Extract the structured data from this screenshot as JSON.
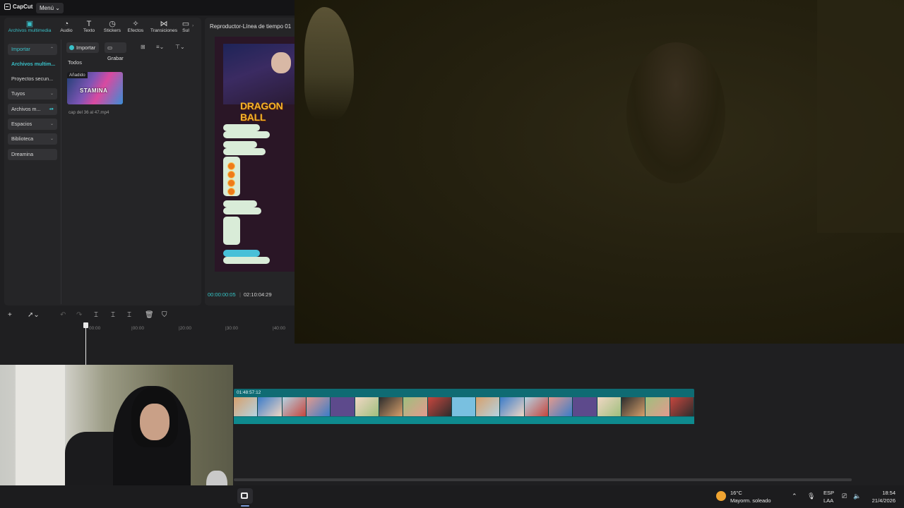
{
  "app": {
    "logo": "CapCut",
    "menu_label": "Menú"
  },
  "toolbar": {
    "tabs": [
      {
        "label": "Archivos multimedia",
        "icon": "media-icon"
      },
      {
        "label": "Audio",
        "icon": "audio-icon"
      },
      {
        "label": "Texto",
        "icon": "text-icon"
      },
      {
        "label": "Stickers",
        "icon": "stickers-icon"
      },
      {
        "label": "Efectos",
        "icon": "effects-icon"
      },
      {
        "label": "Transiciones",
        "icon": "transitions-icon"
      },
      {
        "label": "Sul",
        "icon": "subtitles-icon"
      }
    ]
  },
  "sidebar": {
    "items": [
      {
        "label": "Importar"
      },
      {
        "label": "Archivos multim..."
      },
      {
        "label": "Proyectos secun..."
      },
      {
        "label": "Tuyos"
      },
      {
        "label": "Archivos m..."
      },
      {
        "label": "Espacios"
      },
      {
        "label": "Biblioteca"
      },
      {
        "label": "Dreamina"
      }
    ]
  },
  "media": {
    "import_label": "Importar",
    "record_label": "Grabar",
    "filter_label": "Todos",
    "thumb_badge": "Añadido",
    "thumb_text": "STAMINA",
    "thumb_caption": "cap del 36 al 47.mp4"
  },
  "player": {
    "title": "Reproductor-Línea de tiempo 01",
    "overlay_title": "DRAGON BALL",
    "current_time": "00:00:00:05",
    "total_time": "02:10:04:29",
    "separator": "|"
  },
  "timeline": {
    "ruler": [
      "00:00",
      "|00:00",
      "|20:00",
      "|30:00",
      "|40:00"
    ],
    "clip_label": "01:48:57:12"
  },
  "taskbar": {
    "weather_temp": "16°C",
    "weather_desc": "Mayorm. soleado",
    "lang_line1": "ESP",
    "lang_line2": "LAA",
    "time": "18:54",
    "date": "21/4/2026"
  },
  "colors": {
    "accent": "#39c0c8",
    "track": "#0f6b73"
  }
}
